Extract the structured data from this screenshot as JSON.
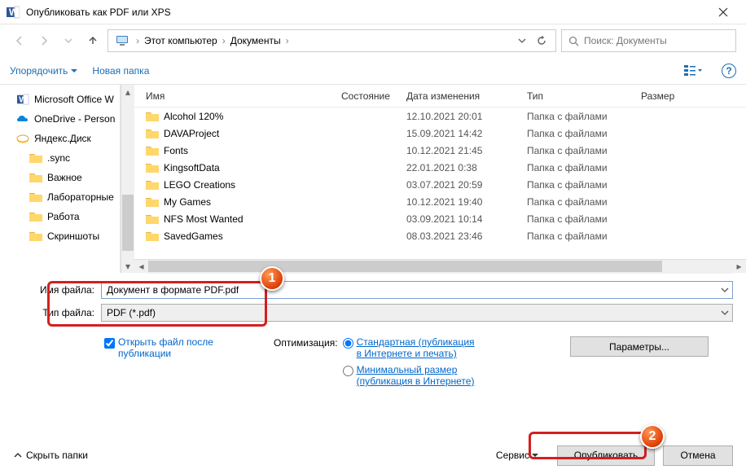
{
  "window": {
    "title": "Опубликовать как PDF или XPS"
  },
  "nav": {
    "crumb1": "Этот компьютер",
    "crumb2": "Документы",
    "search_placeholder": "Поиск: Документы"
  },
  "toolbar": {
    "organize": "Упорядочить",
    "newfolder": "Новая папка"
  },
  "columns": {
    "name": "Имя",
    "state": "Состояние",
    "date": "Дата изменения",
    "type": "Тип",
    "size": "Размер"
  },
  "sidebar": {
    "items": [
      {
        "label": "Microsoft Office W",
        "icon": "word"
      },
      {
        "label": "OneDrive - Person",
        "icon": "onedrive"
      },
      {
        "label": "Яндекс.Диск",
        "icon": "yadisk"
      },
      {
        "label": ".sync",
        "icon": "folder",
        "indent": true
      },
      {
        "label": "Важное",
        "icon": "folder",
        "indent": true
      },
      {
        "label": "Лабораторные",
        "icon": "folder",
        "indent": true
      },
      {
        "label": "Работа",
        "icon": "folder",
        "indent": true
      },
      {
        "label": "Скриншоты",
        "icon": "folder",
        "indent": true
      }
    ]
  },
  "files": [
    {
      "name": "Alcohol 120%",
      "date": "12.10.2021 20:01",
      "type": "Папка с файлами"
    },
    {
      "name": "DAVAProject",
      "date": "15.09.2021 14:42",
      "type": "Папка с файлами"
    },
    {
      "name": "Fonts",
      "date": "10.12.2021 21:45",
      "type": "Папка с файлами"
    },
    {
      "name": "KingsoftData",
      "date": "22.01.2021 0:38",
      "type": "Папка с файлами"
    },
    {
      "name": "LEGO Creations",
      "date": "03.07.2021 20:59",
      "type": "Папка с файлами"
    },
    {
      "name": "My Games",
      "date": "10.12.2021 19:40",
      "type": "Папка с файлами"
    },
    {
      "name": "NFS Most Wanted",
      "date": "03.09.2021 10:14",
      "type": "Папка с файлами"
    },
    {
      "name": "SavedGames",
      "date": "08.03.2021 23:46",
      "type": "Папка с файлами"
    }
  ],
  "form": {
    "filename_label": "Имя файла:",
    "filename_value": "Документ в формате PDF.pdf",
    "filetype_label": "Тип файла:",
    "filetype_value": "PDF (*.pdf)"
  },
  "options": {
    "open_after": "Открыть файл после публикации",
    "optimize_label": "Оптимизация:",
    "radio1": "Стандартная (публикация в Интернете и печать)",
    "radio2": "Минимальный размер (публикация в Интернете)",
    "params_btn": "Параметры..."
  },
  "footer": {
    "hide_folders": "Скрыть папки",
    "tools": "Сервис",
    "publish": "Опубликовать",
    "cancel": "Отмена"
  },
  "badges": {
    "b1": "1",
    "b2": "2"
  }
}
